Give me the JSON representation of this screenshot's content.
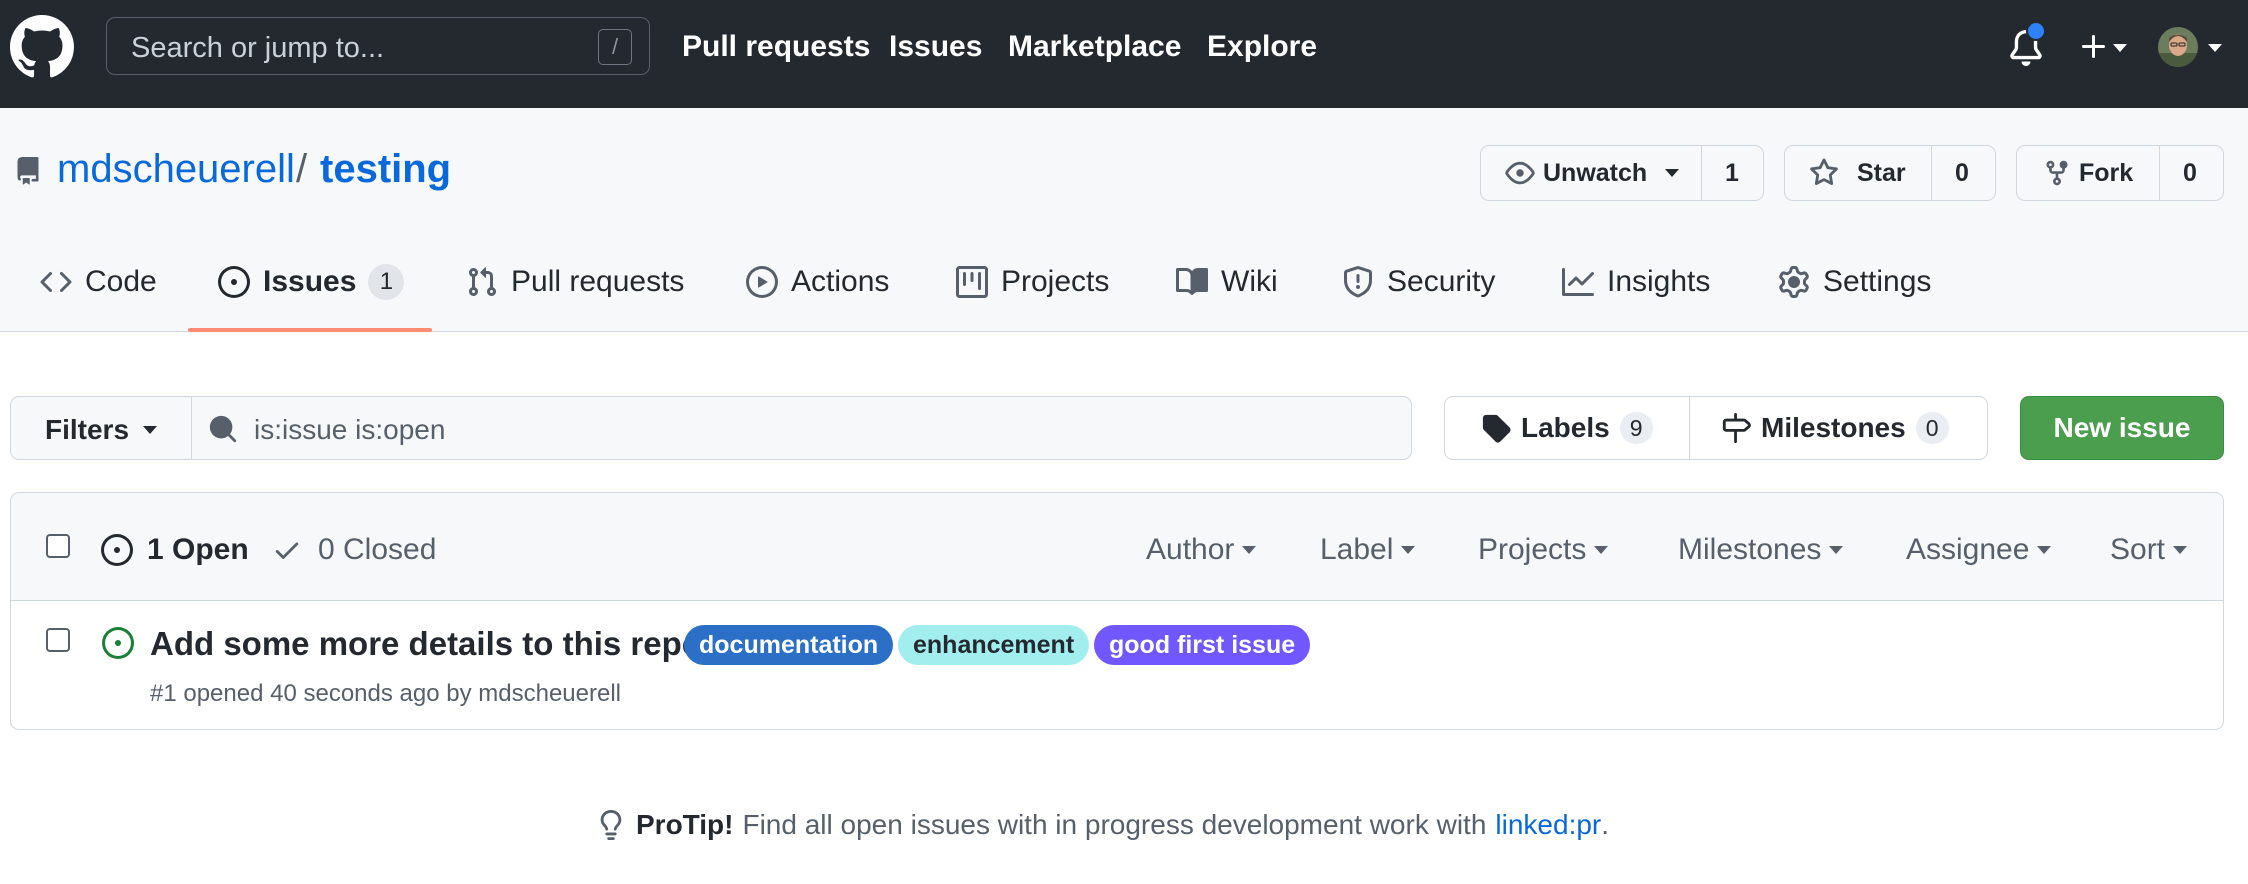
{
  "header": {
    "search_placeholder": "Search or jump to...",
    "search_shortcut": "/",
    "nav": [
      "Pull requests",
      "Issues",
      "Marketplace",
      "Explore"
    ]
  },
  "repo": {
    "owner": "mdscheuerell",
    "separator": "/",
    "name": "testing",
    "watch": {
      "label": "Unwatch",
      "count": "1"
    },
    "star": {
      "label": "Star",
      "count": "0"
    },
    "fork": {
      "label": "Fork",
      "count": "0"
    }
  },
  "tabs": [
    {
      "label": "Code",
      "icon": "code-icon"
    },
    {
      "label": "Issues",
      "icon": "issue-opened-icon",
      "count": "1",
      "selected": true
    },
    {
      "label": "Pull requests",
      "icon": "git-pull-request-icon"
    },
    {
      "label": "Actions",
      "icon": "play-icon"
    },
    {
      "label": "Projects",
      "icon": "project-icon"
    },
    {
      "label": "Wiki",
      "icon": "book-icon"
    },
    {
      "label": "Security",
      "icon": "shield-icon"
    },
    {
      "label": "Insights",
      "icon": "graph-icon"
    },
    {
      "label": "Settings",
      "icon": "gear-icon"
    }
  ],
  "filter_bar": {
    "filters_label": "Filters",
    "query": "is:issue is:open",
    "labels_label": "Labels",
    "labels_count": "9",
    "milestones_label": "Milestones",
    "milestones_count": "0",
    "new_issue_label": "New issue"
  },
  "issues_header": {
    "open_label": "1 Open",
    "closed_label": "0 Closed",
    "filters": [
      "Author",
      "Label",
      "Projects",
      "Milestones",
      "Assignee",
      "Sort"
    ]
  },
  "issues": [
    {
      "title": "Add some more details to this repo",
      "meta": "#1 opened 40 seconds ago by mdscheuerell",
      "labels": [
        {
          "name": "documentation",
          "bg": "#2c6fc7",
          "fg": "#ffffff"
        },
        {
          "name": "enhancement",
          "bg": "#a2eeef",
          "fg": "#24292f"
        },
        {
          "name": "good first issue",
          "bg": "#7057ff",
          "fg": "#ffffff"
        }
      ]
    }
  ],
  "protip": {
    "prefix": "ProTip!",
    "text": "Find all open issues with in progress development work with",
    "link": "linked:pr",
    "suffix": "."
  },
  "colors": {
    "header_bg": "#24292f",
    "link": "#0969da",
    "primary_button": "#4c9e4f",
    "tab_underline": "#fd8c73",
    "open_issue_icon": "#1a7f37"
  }
}
